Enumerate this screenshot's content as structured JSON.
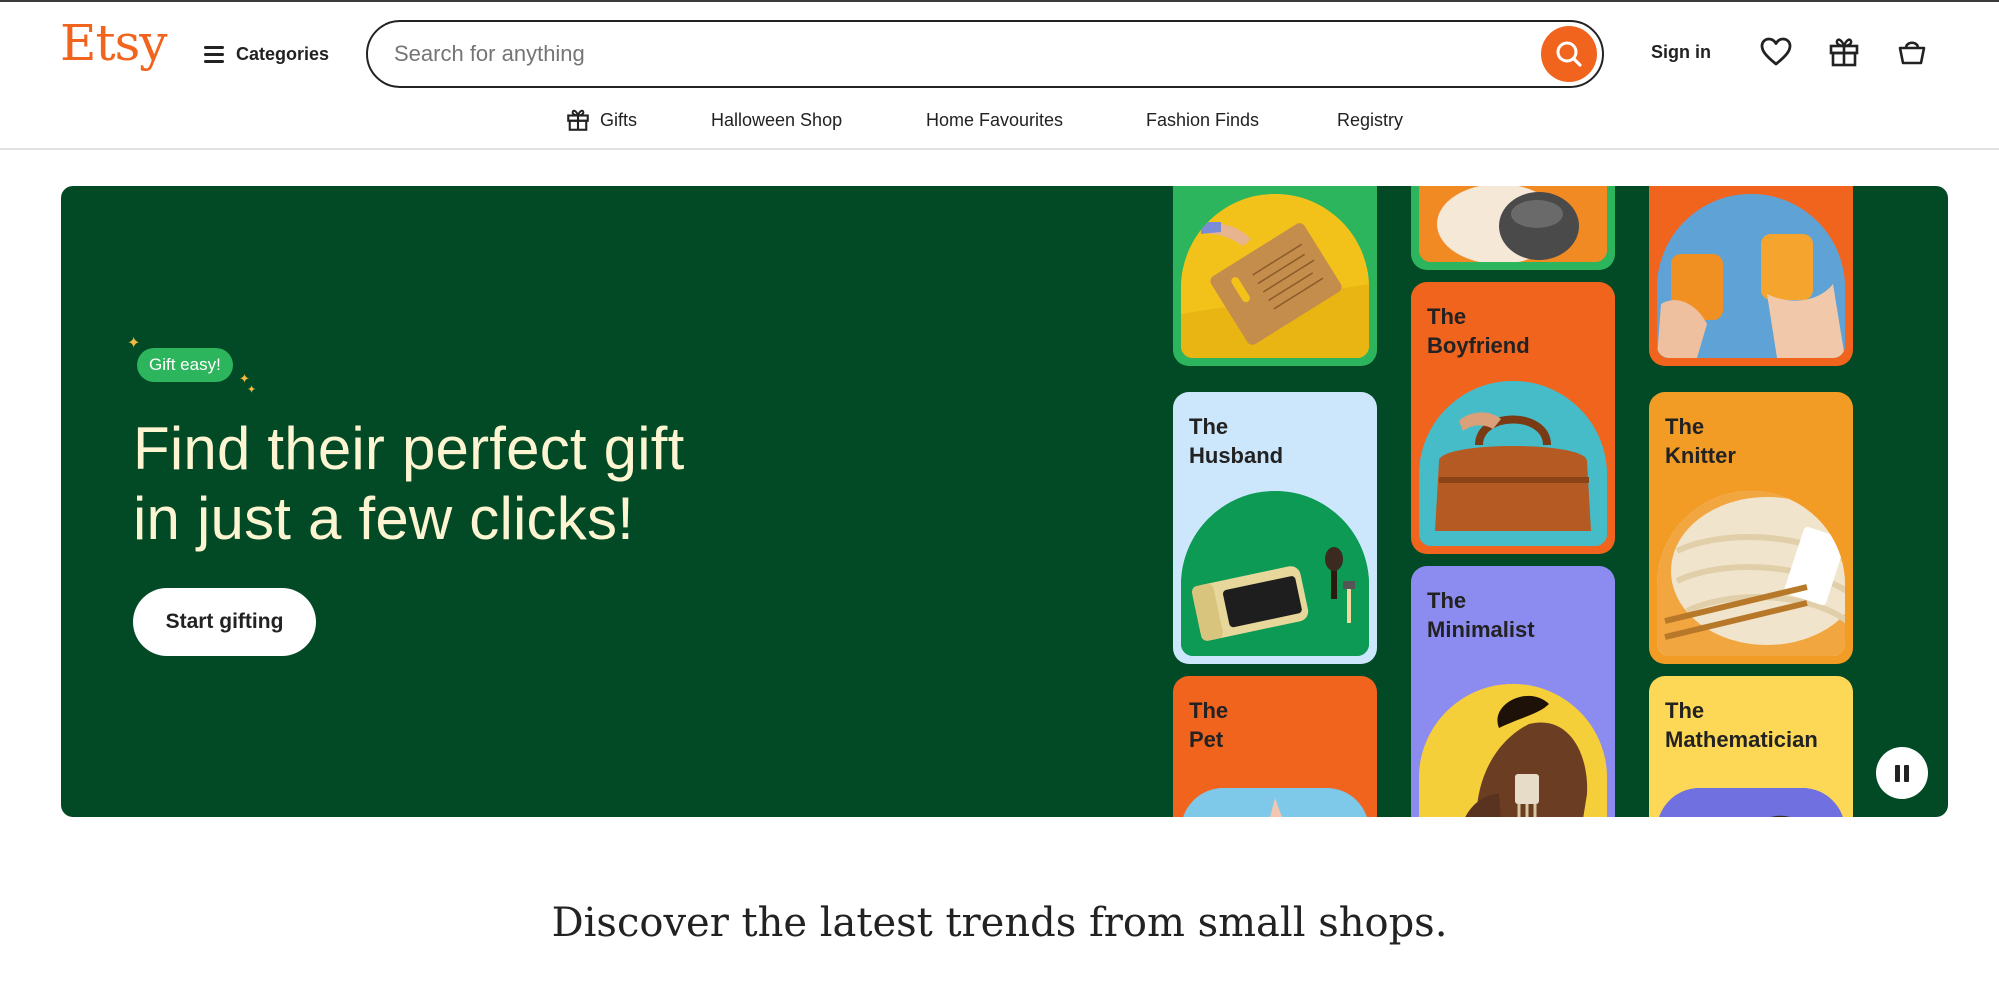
{
  "header": {
    "logo": "Etsy",
    "categories_label": "Categories",
    "search_placeholder": "Search for anything",
    "search_value": "",
    "sign_in": "Sign in",
    "icons": [
      "heart-icon",
      "gift-icon",
      "basket-icon"
    ]
  },
  "subnav": {
    "items": [
      "Gifts",
      "Halloween Shop",
      "Home Favourites",
      "Fashion Finds",
      "Registry"
    ]
  },
  "hero": {
    "badge": "Gift easy!",
    "title_line1": "Find their perfect gift",
    "title_line2": "in just a few clicks!",
    "cta": "Start gifting",
    "cards": [
      {
        "label": "The\nHusband"
      },
      {
        "label": "The\nPet"
      },
      {
        "label": "The\nBoyfriend"
      },
      {
        "label": "The\nMinimalist"
      },
      {
        "label": "The\nKnitter"
      },
      {
        "label": "The\nMathematician"
      }
    ]
  },
  "discover": {
    "heading": "Discover the latest trends from small shops."
  },
  "colors": {
    "brand": "#f1641e",
    "hero_bg": "#024a25",
    "badge": "#2db55d",
    "hero_text": "#fdf5d2"
  }
}
